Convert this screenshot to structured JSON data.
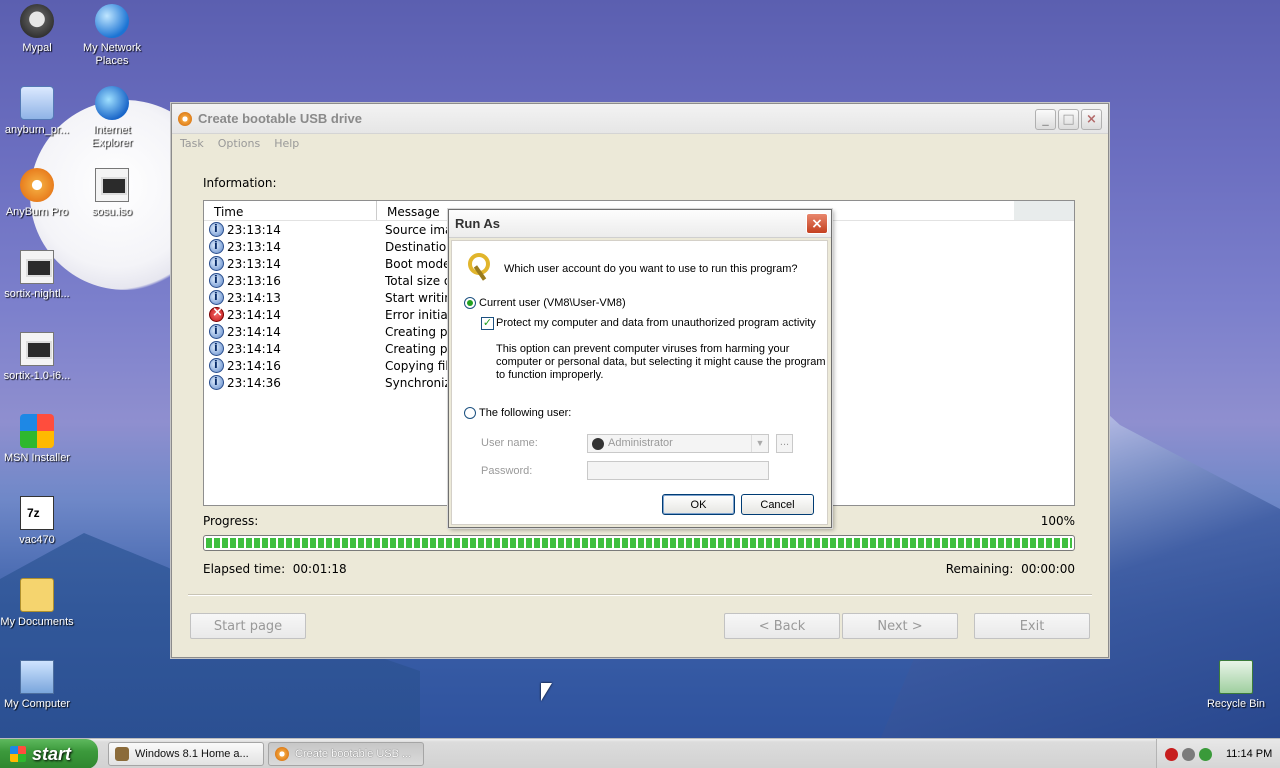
{
  "desktop": {
    "icons": [
      {
        "label": "Mypal"
      },
      {
        "label": "My Network Places"
      },
      {
        "label": "anyburn_pr..."
      },
      {
        "label": "Internet Explorer"
      },
      {
        "label": "AnyBurn Pro"
      },
      {
        "label": "sosu.iso"
      },
      {
        "label": "sortix-nightl..."
      },
      {
        "label": "sortix-1.0-i6..."
      },
      {
        "label": "MSN Installer"
      },
      {
        "label": "vac470"
      },
      {
        "label": "My Documents"
      },
      {
        "label": "My Computer"
      },
      {
        "label": "Recycle Bin"
      }
    ]
  },
  "window": {
    "title": "Create bootable USB drive",
    "menu": [
      "Task",
      "Options",
      "Help"
    ],
    "info_label": "Information:",
    "columns": {
      "time": "Time",
      "message": "Message"
    },
    "rows": [
      {
        "icon": "info-icon",
        "time": "23:13:14",
        "message": "Source ima"
      },
      {
        "icon": "info-icon",
        "time": "23:13:14",
        "message": "Destination"
      },
      {
        "icon": "info-icon",
        "time": "23:13:14",
        "message": "Boot mode:"
      },
      {
        "icon": "info-icon",
        "time": "23:13:16",
        "message": "Total size o"
      },
      {
        "icon": "info-icon",
        "time": "23:14:13",
        "message": "Start writing"
      },
      {
        "icon": "error-icon",
        "time": "23:14:14",
        "message": "Error initiali"
      },
      {
        "icon": "info-icon",
        "time": "23:14:14",
        "message": "Creating pa"
      },
      {
        "icon": "info-icon",
        "time": "23:14:14",
        "message": "Creating pa"
      },
      {
        "icon": "info-icon",
        "time": "23:14:16",
        "message": "Copying file"
      },
      {
        "icon": "info-icon",
        "time": "23:14:36",
        "message": "Synchronizi"
      }
    ],
    "progress_label": "Progress:",
    "progress_percent": "100%",
    "progress_value": 1.0,
    "elapsed_label": "Elapsed time:",
    "elapsed_value": "00:01:18",
    "remaining_label": "Remaining:",
    "remaining_value": "00:00:00",
    "buttons": {
      "start_page": "Start page",
      "back": "< Back",
      "next": "Next >",
      "exit": "Exit"
    }
  },
  "dialog": {
    "title": "Run As",
    "question": "Which user account do you want to use to run this program?",
    "current_user_label": "Current user (VM8\\User-VM8)",
    "protect_label": "Protect my computer and data from unauthorized program activity",
    "protect_note_1": "This option can prevent computer viruses from harming your",
    "protect_note_2": "computer or personal data, but selecting it might cause the program",
    "protect_note_3": "to function improperly.",
    "following_user_label": "The following user:",
    "username_label": "User name:",
    "username_value": "Administrator",
    "password_label": "Password:",
    "browse_label": "...",
    "ok_label": "OK",
    "cancel_label": "Cancel"
  },
  "taskbar": {
    "start_label": "start",
    "tasks": [
      {
        "label": "Windows 8.1 Home a..."
      },
      {
        "label": "Create bootable USB ..."
      }
    ],
    "clock": "11:14 PM"
  }
}
